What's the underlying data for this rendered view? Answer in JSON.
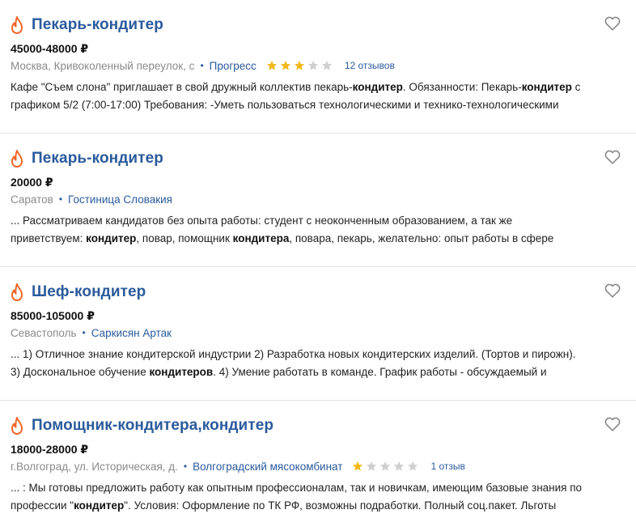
{
  "colors": {
    "title": "#2a5a9c",
    "fire": "#f0672a",
    "star_on": "#f2b91c",
    "star_off": "#cfcfcf"
  },
  "icons": {
    "fire": "fire-icon",
    "heart": "heart-icon",
    "star": "star-icon"
  },
  "vacancies": [
    {
      "title": "Пекарь-кондитер",
      "salary": "45000-48000 ₽",
      "location": "Москва, Кривоколенный переулок, с",
      "separator": "•",
      "company": "Прогресс",
      "rating": 3,
      "reviews": "12 отзывов",
      "desc_line1_a": "Кафе \"Съем слона\" приглашает в свой дружный коллектив пекарь-",
      "desc_line1_b": "кондитер",
      "desc_line1_c": ". Обязанности: Пекарь-",
      "desc_line1_d": "кондитер",
      "desc_line1_e": " с",
      "desc_line2": "графиком 5/2 (7:00-17:00) Требования: -Уметь пользоваться технологическими и технико-технологическими"
    },
    {
      "title": "Пекарь-кондитер",
      "salary": "20000 ₽",
      "location": "Саратов",
      "separator": "•",
      "company": "Гостиница Словакия",
      "desc_line1": "... Рассматриваем кандидатов без опыта работы: студент с неоконченным образованием, а так же",
      "desc_line2_a": "приветствуем: ",
      "desc_line2_b": "кондитер",
      "desc_line2_c": ", повар, помощник ",
      "desc_line2_d": "кондитера",
      "desc_line2_e": ", повара, пекарь, желательно: опыт работы в сфере"
    },
    {
      "title": "Шеф-кондитер",
      "salary": "85000-105000 ₽",
      "location": "Севастополь",
      "separator": "•",
      "company": "Саркисян Артак",
      "desc_line1": "... 1) Отличное знание кондитерской индустрии 2) Разработка новых кондитерских изделий. (Тортов и пирожн).",
      "desc_line2_a": "3) Доскональное обучение ",
      "desc_line2_b": "кондитеров",
      "desc_line2_c": ". 4) Умение работать в команде. График работы - обсуждаемый и"
    },
    {
      "title": "Помощник-кондитера,кондитер",
      "salary": "18000-28000 ₽",
      "location": "г.Волгоград, ул. Историческая, д.",
      "separator": "•",
      "company": "Волгоградский мясокомбинат",
      "rating": 1,
      "reviews": "1 отзыв",
      "desc_line1": "... : Мы готовы предложить работу как опытным профессионалам, так и новичкам, имеющим базовые знания по",
      "desc_line2_a": "профессии \"",
      "desc_line2_b": "кондитер",
      "desc_line2_c": "\". Условия: Оформление по ТК РФ, возможны подработки. Полный соц.пакет. Льготы"
    }
  ]
}
